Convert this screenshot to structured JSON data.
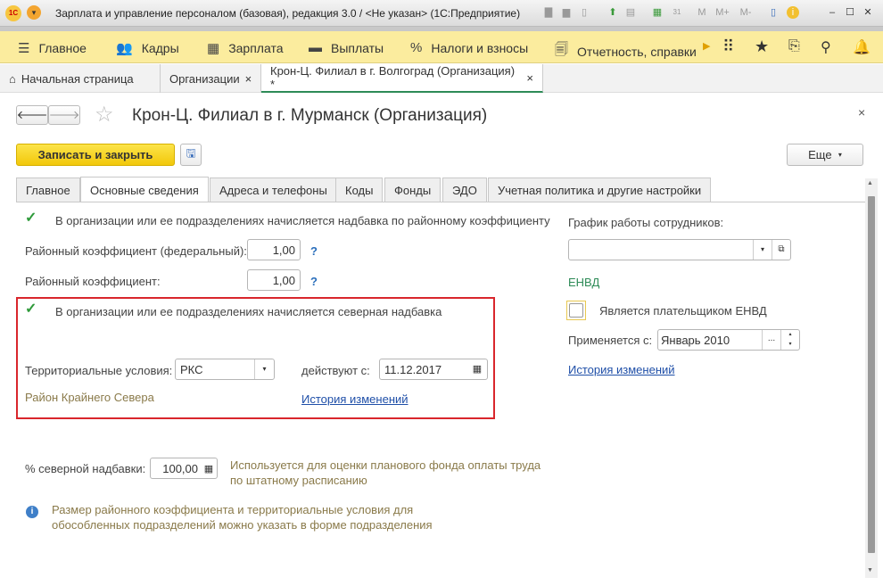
{
  "window": {
    "title": "Зарплата и управление персоналом (базовая), редакция 3.0 / <Не указан>  (1С:Предприятие)",
    "logo": "1С",
    "toolbar_m": [
      "M",
      "M+",
      "M-"
    ],
    "calendar_day": "31"
  },
  "menu": [
    "Главное",
    "Кадры",
    "Зарплата",
    "Выплаты",
    "Налоги и взносы",
    "Отчетность, справки"
  ],
  "open_tabs": [
    {
      "label": "Начальная страница"
    },
    {
      "label": "Организации"
    },
    {
      "label": "Крон-Ц. Филиал в г. Волгоград (Организация) *"
    }
  ],
  "form": {
    "title": "Крон-Ц. Филиал в г. Мурманск (Организация)",
    "save_close": "Записать и закрыть",
    "more": "Еще",
    "tabs": [
      "Главное",
      "Основные сведения",
      "Адреса и телефоны",
      "Коды",
      "Фонды",
      "ЭДО",
      "Учетная политика и другие настройки"
    ],
    "district_check": "В организации или ее подразделениях начисляется надбавка по районному коэффициенту",
    "fed_coef_label": "Районный коэффициент (федеральный):",
    "fed_coef": "1,00",
    "coef_label": "Районный коэффициент:",
    "coef": "1,00",
    "q": "?",
    "north_check": "В организации или ее подразделениях начисляется северная надбавка",
    "terr_label": "Территориальные условия:",
    "terr_value": "РКС",
    "valid_label": "действуют с:",
    "valid_date": "11.12.2017",
    "terr_desc": "Район Крайнего Севера",
    "history": "История изменений",
    "pct_label": "% северной надбавки:",
    "pct_value": "100,00",
    "pct_hint": "Используется для оценки планового фонда оплаты труда по штатному расписанию",
    "info": "Размер районного коэффициента и территориальные условия для обособленных подразделений можно указать в форме подразделения",
    "schedule_label": "График работы сотрудников:",
    "schedule_value": "",
    "envd_heading": "ЕНВД",
    "envd_check": "Является плательщиком ЕНВД",
    "applies_label": "Применяется с:",
    "applies_value": "Январь 2010",
    "envd_history": "История изменений"
  }
}
